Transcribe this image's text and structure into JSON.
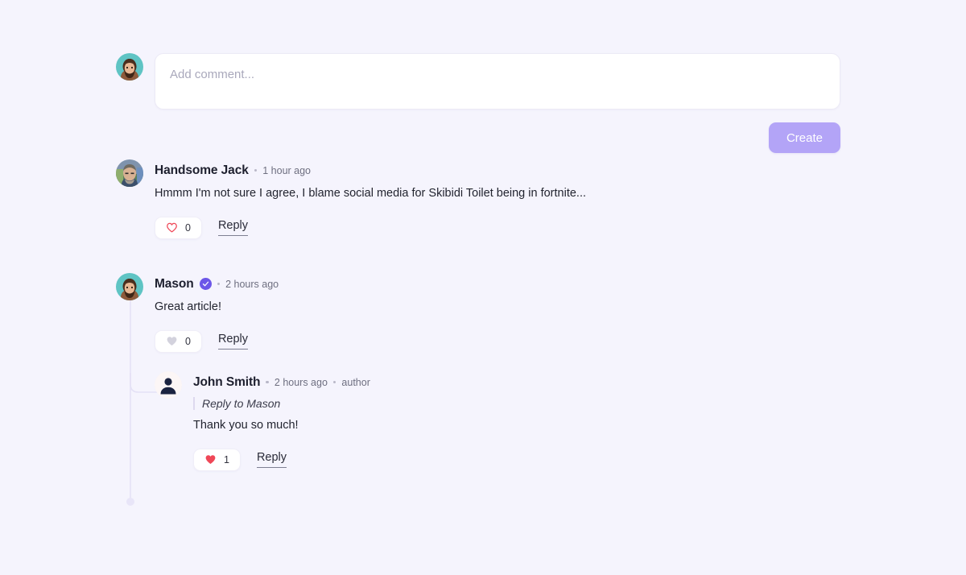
{
  "theme": {
    "background": "#f5f4fd",
    "accent": "#b3a4f7",
    "verified_badge": "#6c56e8",
    "heart_red": "#ef4757",
    "heart_gray": "#d3d2dd",
    "thread_line": "#e4e1f6"
  },
  "composer": {
    "placeholder": "Add comment...",
    "value": "",
    "submit_label": "Create",
    "avatar": "user-avatar-mason"
  },
  "comments": [
    {
      "id": "jack",
      "author": "Handsome Jack",
      "verified": false,
      "separator": "•",
      "time": "1 hour ago",
      "tag": "",
      "text": "Hmmm I'm not sure I agree, I blame social media for Skibidi Toilet being in fortnite...",
      "quote": "",
      "like_count": "0",
      "liked": false,
      "heart_style": "outline-red",
      "reply_label": "Reply",
      "avatar": "user-avatar-jack"
    },
    {
      "id": "mason",
      "author": "Mason",
      "verified": true,
      "separator": "•",
      "time": "2 hours ago",
      "tag": "",
      "text": "Great article!",
      "quote": "",
      "like_count": "0",
      "liked": false,
      "heart_style": "filled-gray",
      "reply_label": "Reply",
      "avatar": "user-avatar-mason"
    },
    {
      "id": "john",
      "author": "John Smith",
      "verified": false,
      "separator": "•",
      "time": "2 hours ago",
      "tag": "author",
      "text": "Thank you so much!",
      "quote": "Reply to Mason",
      "like_count": "1",
      "liked": true,
      "heart_style": "filled-red",
      "reply_label": "Reply",
      "avatar": "user-avatar-default"
    }
  ]
}
